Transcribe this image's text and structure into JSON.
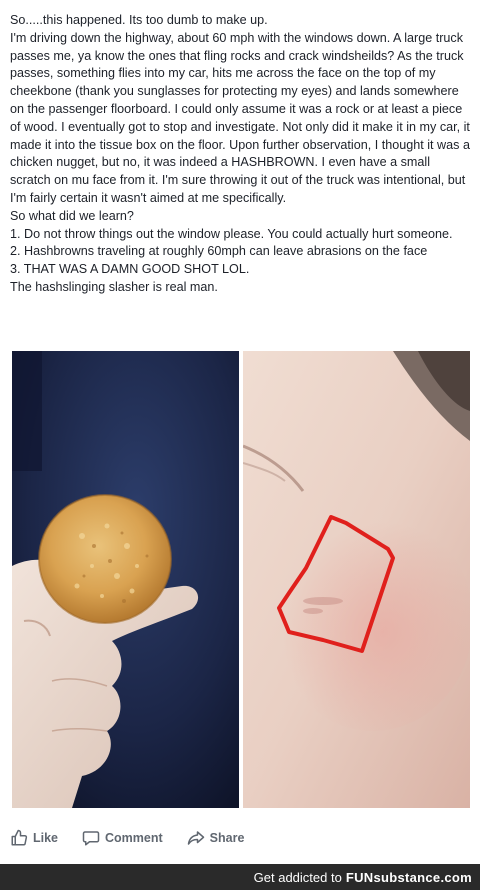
{
  "post": {
    "lines": [
      "So.....this happened. Its too dumb to make up.",
      "I'm driving down the highway, about 60 mph with the windows down. A large truck passes me, ya know the ones that fling rocks and crack windsheilds? As the truck passes, something flies into my car, hits me across the face on the top of my cheekbone (thank you sunglasses for protecting my eyes) and lands somewhere on the passenger floorboard. I could only assume it was a rock or at least a piece of wood. I eventually got to stop and investigate. Not only did it make it in my car, it made it into the tissue box on the floor. Upon further observation, I thought it was a chicken nugget, but no, it was indeed a HASHBROWN. I even have a small scratch on mu face from it. I'm sure throwing it out of the truck was intentional, but I'm fairly certain it wasn't aimed at me specifically.",
      "So what did we learn?",
      "1. Do not throw things out the window please. You could actually hurt someone.",
      "2. Hashbrowns traveling at roughly 60mph can leave abrasions on the face",
      "3. THAT WAS A DAMN GOOD SHOT LOL.",
      "The hashslinging slasher is real man."
    ]
  },
  "photos": {
    "left_icon": "hashbrown-photo",
    "right_icon": "cheek-scratch-photo",
    "annotation_color": "#e0201c"
  },
  "actions": {
    "like_label": "Like",
    "comment_label": "Comment",
    "share_label": "Share"
  },
  "footer": {
    "tagline": "Get addicted to",
    "brand": "FUNsubstance.com"
  },
  "colors": {
    "text": "#1d2129",
    "action_text": "#606770",
    "footer_bg": "#2a2a2a"
  }
}
